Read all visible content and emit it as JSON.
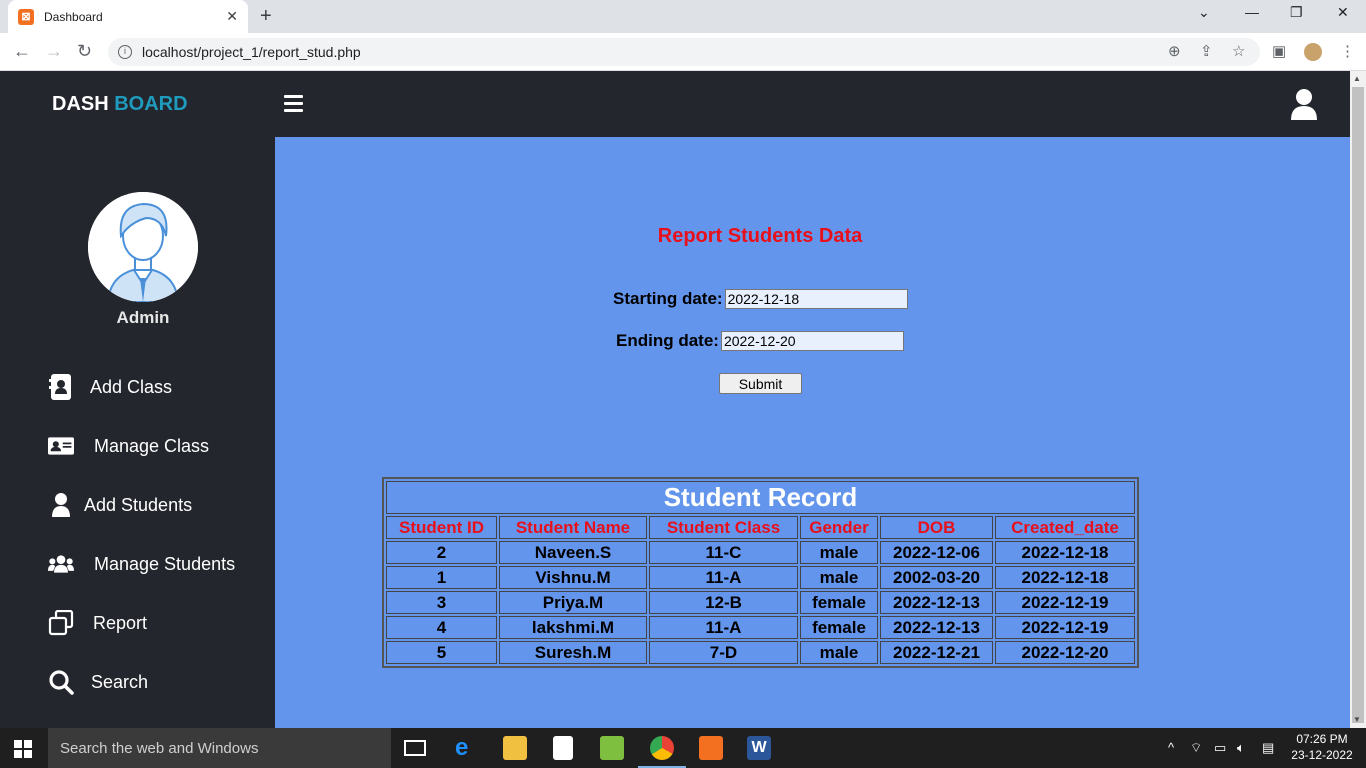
{
  "browser": {
    "tab_title": "Dashboard",
    "url": "localhost/project_1/report_stud.php"
  },
  "header": {
    "brand_part1": "DASH",
    "brand_part2": "BOARD"
  },
  "sidebar": {
    "user_name": "Admin",
    "items": [
      {
        "label": "Add Class",
        "icon": "contact-book-icon"
      },
      {
        "label": "Manage Class",
        "icon": "id-card-icon"
      },
      {
        "label": "Add Students",
        "icon": "user-icon"
      },
      {
        "label": "Manage Students",
        "icon": "users-icon"
      },
      {
        "label": "Report",
        "icon": "clone-icon"
      },
      {
        "label": "Search",
        "icon": "search-icon"
      }
    ]
  },
  "main": {
    "title": "Report Students Data",
    "start_label": "Starting date:",
    "start_value": "2022-12-18",
    "end_label": "Ending date:",
    "end_value": "2022-12-20",
    "submit_label": "Submit"
  },
  "table": {
    "caption": "Student Record",
    "headers": [
      "Student ID",
      "Student Name",
      "Student Class",
      "Gender",
      "DOB",
      "Created_date"
    ],
    "rows": [
      [
        "2",
        "Naveen.S",
        "11-C",
        "male",
        "2022-12-06",
        "2022-12-18"
      ],
      [
        "1",
        "Vishnu.M",
        "11-A",
        "male",
        "2002-03-20",
        "2022-12-18"
      ],
      [
        "3",
        "Priya.M",
        "12-B",
        "female",
        "2022-12-13",
        "2022-12-19"
      ],
      [
        "4",
        "lakshmi.M",
        "11-A",
        "female",
        "2022-12-13",
        "2022-12-19"
      ],
      [
        "5",
        "Suresh.M",
        "7-D",
        "male",
        "2022-12-21",
        "2022-12-20"
      ]
    ]
  },
  "taskbar": {
    "search_placeholder": "Search the web and Windows",
    "time": "07:26 PM",
    "date": "23-12-2022"
  },
  "colors": {
    "header_bg": "#23262d",
    "main_bg": "#6495ed",
    "accent_red": "#e8101a",
    "brand_accent": "#1f9bbd"
  }
}
